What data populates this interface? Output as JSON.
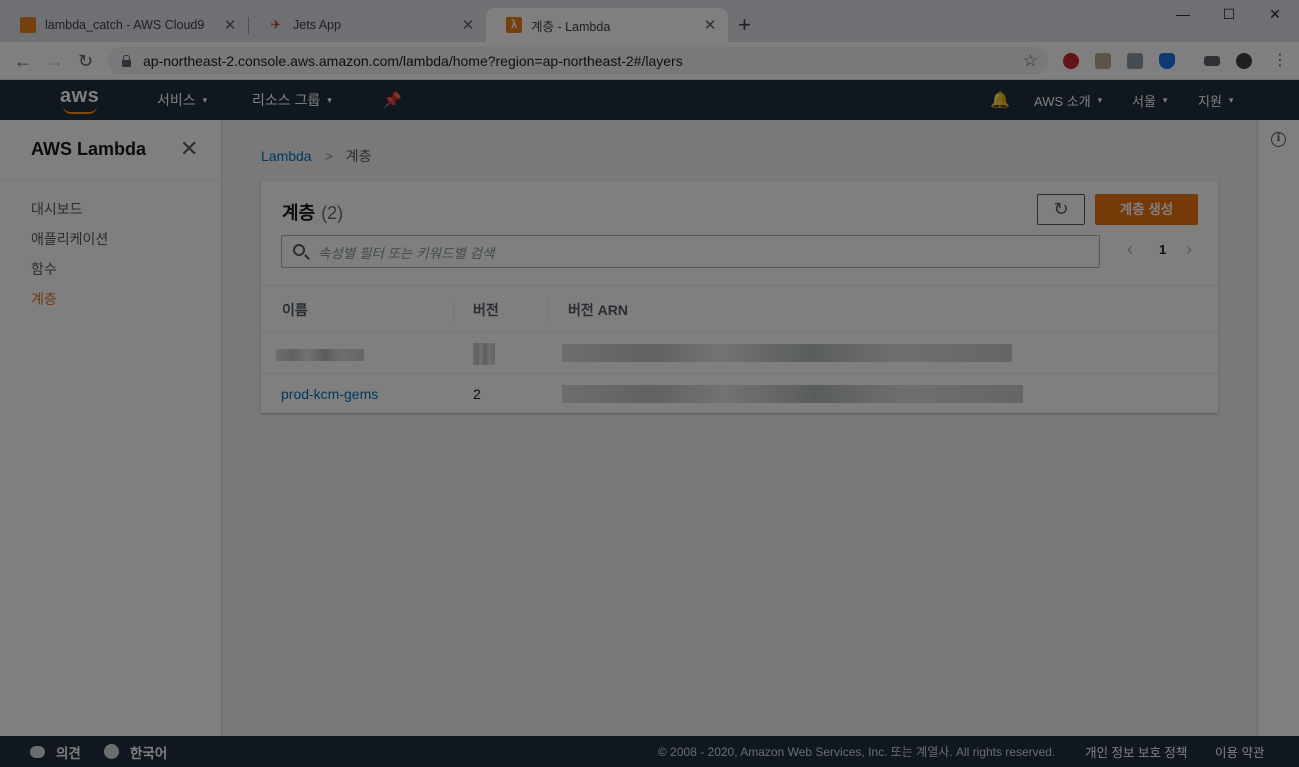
{
  "browser": {
    "tabs": [
      {
        "title": "lambda_catch - AWS Cloud9",
        "favicon": "cloud9-icon"
      },
      {
        "title": "Jets App",
        "favicon": "jets-icon"
      },
      {
        "title": "계층 - Lambda",
        "favicon": "lambda-icon"
      }
    ],
    "url": "ap-northeast-2.console.aws.amazon.com/lambda/home?region=ap-northeast-2#/layers"
  },
  "topnav": {
    "logo": "aws",
    "services": "서비스",
    "resource_groups": "리소스 그룹",
    "about_aws": "AWS 소개",
    "region": "서울",
    "support": "지원"
  },
  "sidebar": {
    "title": "AWS Lambda",
    "items": [
      {
        "label": "대시보드",
        "active": false
      },
      {
        "label": "애플리케이션",
        "active": false
      },
      {
        "label": "함수",
        "active": false
      },
      {
        "label": "계층",
        "active": true
      }
    ]
  },
  "breadcrumb": {
    "root": "Lambda",
    "current": "계층"
  },
  "panel": {
    "title": "계층",
    "count": "(2)",
    "create_label": "계층 생성",
    "search_placeholder": "속성별 필터 또는 키워드별 검색",
    "page": "1",
    "columns": [
      "이름",
      "버전",
      "버전 ARN"
    ],
    "rows": [
      {
        "name": "",
        "version": "",
        "arn": ""
      },
      {
        "name": "prod-kcm-gems",
        "version": "2",
        "arn": ""
      }
    ]
  },
  "footer": {
    "feedback": "의견",
    "language": "한국어",
    "copyright": "© 2008 - 2020, Amazon Web Services, Inc. 또는 계열사. All rights reserved.",
    "privacy": "개인 정보 보호 정책",
    "terms": "이용 약관"
  },
  "colors": {
    "accent": "#ec7211",
    "nav_bg": "#232f3e",
    "link": "#0073bb"
  }
}
